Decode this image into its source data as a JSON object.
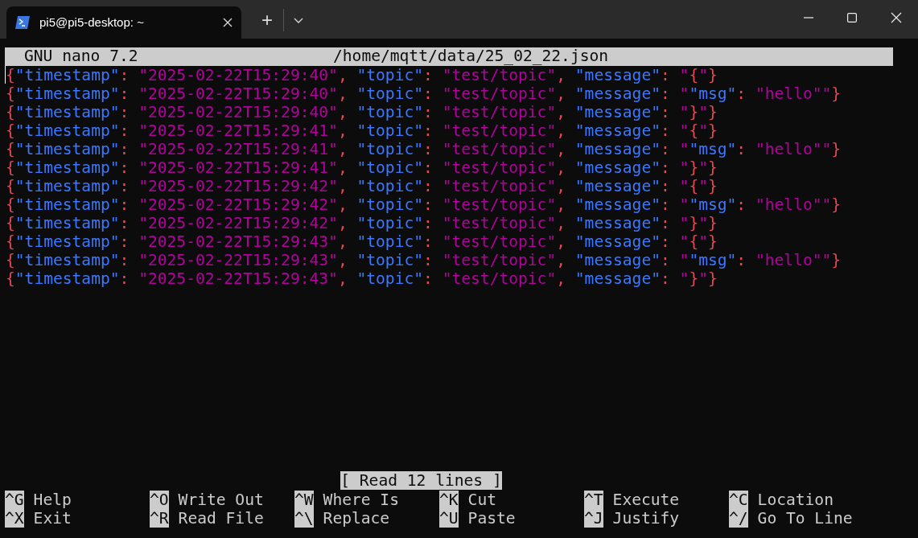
{
  "window": {
    "tab_title": "pi5@pi5-desktop: ~",
    "new_tab": "+"
  },
  "nano": {
    "version": "GNU nano 7.2",
    "file": "/home/mqtt/data/25_02_22.json"
  },
  "lines": [
    [
      {
        "kind": "brace",
        "text": "{"
      },
      {
        "kind": "key",
        "text": "\"timestamp\""
      },
      {
        "kind": "punct",
        "text": ": "
      },
      {
        "kind": "string",
        "text": "\"2025-02-22T15:29:40\""
      },
      {
        "kind": "punct",
        "text": ", "
      },
      {
        "kind": "key",
        "text": "\"topic\""
      },
      {
        "kind": "punct",
        "text": ": "
      },
      {
        "kind": "string",
        "text": "\"test/topic\""
      },
      {
        "kind": "punct",
        "text": ", "
      },
      {
        "kind": "key",
        "text": "\"message\""
      },
      {
        "kind": "punct",
        "text": ": "
      },
      {
        "kind": "string",
        "text": "\""
      },
      {
        "kind": "brace",
        "text": "{"
      },
      {
        "kind": "string",
        "text": "\""
      },
      {
        "kind": "brace",
        "text": "}"
      }
    ],
    [
      {
        "kind": "brace",
        "text": "{"
      },
      {
        "kind": "key",
        "text": "\"timestamp\""
      },
      {
        "kind": "punct",
        "text": ": "
      },
      {
        "kind": "string",
        "text": "\"2025-02-22T15:29:40\""
      },
      {
        "kind": "punct",
        "text": ", "
      },
      {
        "kind": "key",
        "text": "\"topic\""
      },
      {
        "kind": "punct",
        "text": ": "
      },
      {
        "kind": "string",
        "text": "\"test/topic\""
      },
      {
        "kind": "punct",
        "text": ", "
      },
      {
        "kind": "key",
        "text": "\"message\""
      },
      {
        "kind": "punct",
        "text": ": "
      },
      {
        "kind": "string",
        "text": "\""
      },
      {
        "kind": "key",
        "text": "\"msg\""
      },
      {
        "kind": "punct",
        "text": ": "
      },
      {
        "kind": "string",
        "text": "\"hello\"\""
      },
      {
        "kind": "brace",
        "text": "}"
      }
    ],
    [
      {
        "kind": "brace",
        "text": "{"
      },
      {
        "kind": "key",
        "text": "\"timestamp\""
      },
      {
        "kind": "punct",
        "text": ": "
      },
      {
        "kind": "string",
        "text": "\"2025-02-22T15:29:40\""
      },
      {
        "kind": "punct",
        "text": ", "
      },
      {
        "kind": "key",
        "text": "\"topic\""
      },
      {
        "kind": "punct",
        "text": ": "
      },
      {
        "kind": "string",
        "text": "\"test/topic\""
      },
      {
        "kind": "punct",
        "text": ", "
      },
      {
        "kind": "key",
        "text": "\"message\""
      },
      {
        "kind": "punct",
        "text": ": "
      },
      {
        "kind": "string",
        "text": "\""
      },
      {
        "kind": "brace",
        "text": "}"
      },
      {
        "kind": "string",
        "text": "\""
      },
      {
        "kind": "brace",
        "text": "}"
      }
    ],
    [
      {
        "kind": "brace",
        "text": "{"
      },
      {
        "kind": "key",
        "text": "\"timestamp\""
      },
      {
        "kind": "punct",
        "text": ": "
      },
      {
        "kind": "string",
        "text": "\"2025-02-22T15:29:41\""
      },
      {
        "kind": "punct",
        "text": ", "
      },
      {
        "kind": "key",
        "text": "\"topic\""
      },
      {
        "kind": "punct",
        "text": ": "
      },
      {
        "kind": "string",
        "text": "\"test/topic\""
      },
      {
        "kind": "punct",
        "text": ", "
      },
      {
        "kind": "key",
        "text": "\"message\""
      },
      {
        "kind": "punct",
        "text": ": "
      },
      {
        "kind": "string",
        "text": "\""
      },
      {
        "kind": "brace",
        "text": "{"
      },
      {
        "kind": "string",
        "text": "\""
      },
      {
        "kind": "brace",
        "text": "}"
      }
    ],
    [
      {
        "kind": "brace",
        "text": "{"
      },
      {
        "kind": "key",
        "text": "\"timestamp\""
      },
      {
        "kind": "punct",
        "text": ": "
      },
      {
        "kind": "string",
        "text": "\"2025-02-22T15:29:41\""
      },
      {
        "kind": "punct",
        "text": ", "
      },
      {
        "kind": "key",
        "text": "\"topic\""
      },
      {
        "kind": "punct",
        "text": ": "
      },
      {
        "kind": "string",
        "text": "\"test/topic\""
      },
      {
        "kind": "punct",
        "text": ", "
      },
      {
        "kind": "key",
        "text": "\"message\""
      },
      {
        "kind": "punct",
        "text": ": "
      },
      {
        "kind": "string",
        "text": "\""
      },
      {
        "kind": "key",
        "text": "\"msg\""
      },
      {
        "kind": "punct",
        "text": ": "
      },
      {
        "kind": "string",
        "text": "\"hello\"\""
      },
      {
        "kind": "brace",
        "text": "}"
      }
    ],
    [
      {
        "kind": "brace",
        "text": "{"
      },
      {
        "kind": "key",
        "text": "\"timestamp\""
      },
      {
        "kind": "punct",
        "text": ": "
      },
      {
        "kind": "string",
        "text": "\"2025-02-22T15:29:41\""
      },
      {
        "kind": "punct",
        "text": ", "
      },
      {
        "kind": "key",
        "text": "\"topic\""
      },
      {
        "kind": "punct",
        "text": ": "
      },
      {
        "kind": "string",
        "text": "\"test/topic\""
      },
      {
        "kind": "punct",
        "text": ", "
      },
      {
        "kind": "key",
        "text": "\"message\""
      },
      {
        "kind": "punct",
        "text": ": "
      },
      {
        "kind": "string",
        "text": "\""
      },
      {
        "kind": "brace",
        "text": "}"
      },
      {
        "kind": "string",
        "text": "\""
      },
      {
        "kind": "brace",
        "text": "}"
      }
    ],
    [
      {
        "kind": "brace",
        "text": "{"
      },
      {
        "kind": "key",
        "text": "\"timestamp\""
      },
      {
        "kind": "punct",
        "text": ": "
      },
      {
        "kind": "string",
        "text": "\"2025-02-22T15:29:42\""
      },
      {
        "kind": "punct",
        "text": ", "
      },
      {
        "kind": "key",
        "text": "\"topic\""
      },
      {
        "kind": "punct",
        "text": ": "
      },
      {
        "kind": "string",
        "text": "\"test/topic\""
      },
      {
        "kind": "punct",
        "text": ", "
      },
      {
        "kind": "key",
        "text": "\"message\""
      },
      {
        "kind": "punct",
        "text": ": "
      },
      {
        "kind": "string",
        "text": "\""
      },
      {
        "kind": "brace",
        "text": "{"
      },
      {
        "kind": "string",
        "text": "\""
      },
      {
        "kind": "brace",
        "text": "}"
      }
    ],
    [
      {
        "kind": "brace",
        "text": "{"
      },
      {
        "kind": "key",
        "text": "\"timestamp\""
      },
      {
        "kind": "punct",
        "text": ": "
      },
      {
        "kind": "string",
        "text": "\"2025-02-22T15:29:42\""
      },
      {
        "kind": "punct",
        "text": ", "
      },
      {
        "kind": "key",
        "text": "\"topic\""
      },
      {
        "kind": "punct",
        "text": ": "
      },
      {
        "kind": "string",
        "text": "\"test/topic\""
      },
      {
        "kind": "punct",
        "text": ", "
      },
      {
        "kind": "key",
        "text": "\"message\""
      },
      {
        "kind": "punct",
        "text": ": "
      },
      {
        "kind": "string",
        "text": "\""
      },
      {
        "kind": "key",
        "text": "\"msg\""
      },
      {
        "kind": "punct",
        "text": ": "
      },
      {
        "kind": "string",
        "text": "\"hello\"\""
      },
      {
        "kind": "brace",
        "text": "}"
      }
    ],
    [
      {
        "kind": "brace",
        "text": "{"
      },
      {
        "kind": "key",
        "text": "\"timestamp\""
      },
      {
        "kind": "punct",
        "text": ": "
      },
      {
        "kind": "string",
        "text": "\"2025-02-22T15:29:42\""
      },
      {
        "kind": "punct",
        "text": ", "
      },
      {
        "kind": "key",
        "text": "\"topic\""
      },
      {
        "kind": "punct",
        "text": ": "
      },
      {
        "kind": "string",
        "text": "\"test/topic\""
      },
      {
        "kind": "punct",
        "text": ", "
      },
      {
        "kind": "key",
        "text": "\"message\""
      },
      {
        "kind": "punct",
        "text": ": "
      },
      {
        "kind": "string",
        "text": "\""
      },
      {
        "kind": "brace",
        "text": "}"
      },
      {
        "kind": "string",
        "text": "\""
      },
      {
        "kind": "brace",
        "text": "}"
      }
    ],
    [
      {
        "kind": "brace",
        "text": "{"
      },
      {
        "kind": "key",
        "text": "\"timestamp\""
      },
      {
        "kind": "punct",
        "text": ": "
      },
      {
        "kind": "string",
        "text": "\"2025-02-22T15:29:43\""
      },
      {
        "kind": "punct",
        "text": ", "
      },
      {
        "kind": "key",
        "text": "\"topic\""
      },
      {
        "kind": "punct",
        "text": ": "
      },
      {
        "kind": "string",
        "text": "\"test/topic\""
      },
      {
        "kind": "punct",
        "text": ", "
      },
      {
        "kind": "key",
        "text": "\"message\""
      },
      {
        "kind": "punct",
        "text": ": "
      },
      {
        "kind": "string",
        "text": "\""
      },
      {
        "kind": "brace",
        "text": "{"
      },
      {
        "kind": "string",
        "text": "\""
      },
      {
        "kind": "brace",
        "text": "}"
      }
    ],
    [
      {
        "kind": "brace",
        "text": "{"
      },
      {
        "kind": "key",
        "text": "\"timestamp\""
      },
      {
        "kind": "punct",
        "text": ": "
      },
      {
        "kind": "string",
        "text": "\"2025-02-22T15:29:43\""
      },
      {
        "kind": "punct",
        "text": ", "
      },
      {
        "kind": "key",
        "text": "\"topic\""
      },
      {
        "kind": "punct",
        "text": ": "
      },
      {
        "kind": "string",
        "text": "\"test/topic\""
      },
      {
        "kind": "punct",
        "text": ", "
      },
      {
        "kind": "key",
        "text": "\"message\""
      },
      {
        "kind": "punct",
        "text": ": "
      },
      {
        "kind": "string",
        "text": "\""
      },
      {
        "kind": "key",
        "text": "\"msg\""
      },
      {
        "kind": "punct",
        "text": ": "
      },
      {
        "kind": "string",
        "text": "\"hello\"\""
      },
      {
        "kind": "brace",
        "text": "}"
      }
    ],
    [
      {
        "kind": "brace",
        "text": "{"
      },
      {
        "kind": "key",
        "text": "\"timestamp\""
      },
      {
        "kind": "punct",
        "text": ": "
      },
      {
        "kind": "string",
        "text": "\"2025-02-22T15:29:43\""
      },
      {
        "kind": "punct",
        "text": ", "
      },
      {
        "kind": "key",
        "text": "\"topic\""
      },
      {
        "kind": "punct",
        "text": ": "
      },
      {
        "kind": "string",
        "text": "\"test/topic\""
      },
      {
        "kind": "punct",
        "text": ", "
      },
      {
        "kind": "key",
        "text": "\"message\""
      },
      {
        "kind": "punct",
        "text": ": "
      },
      {
        "kind": "string",
        "text": "\""
      },
      {
        "kind": "brace",
        "text": "}"
      },
      {
        "kind": "string",
        "text": "\""
      },
      {
        "kind": "brace",
        "text": "}"
      }
    ]
  ],
  "status": "[ Read 12 lines ]",
  "shortcuts": [
    [
      {
        "key": "^G",
        "label": "Help"
      },
      {
        "key": "^O",
        "label": "Write Out"
      },
      {
        "key": "^W",
        "label": "Where Is"
      },
      {
        "key": "^K",
        "label": "Cut"
      },
      {
        "key": "^T",
        "label": "Execute"
      },
      {
        "key": "^C",
        "label": "Location"
      }
    ],
    [
      {
        "key": "^X",
        "label": "Exit"
      },
      {
        "key": "^R",
        "label": "Read File"
      },
      {
        "key": "^\\",
        "label": "Replace"
      },
      {
        "key": "^U",
        "label": "Paste"
      },
      {
        "key": "^J",
        "label": "Justify"
      },
      {
        "key": "^/",
        "label": "Go To Line"
      }
    ]
  ]
}
